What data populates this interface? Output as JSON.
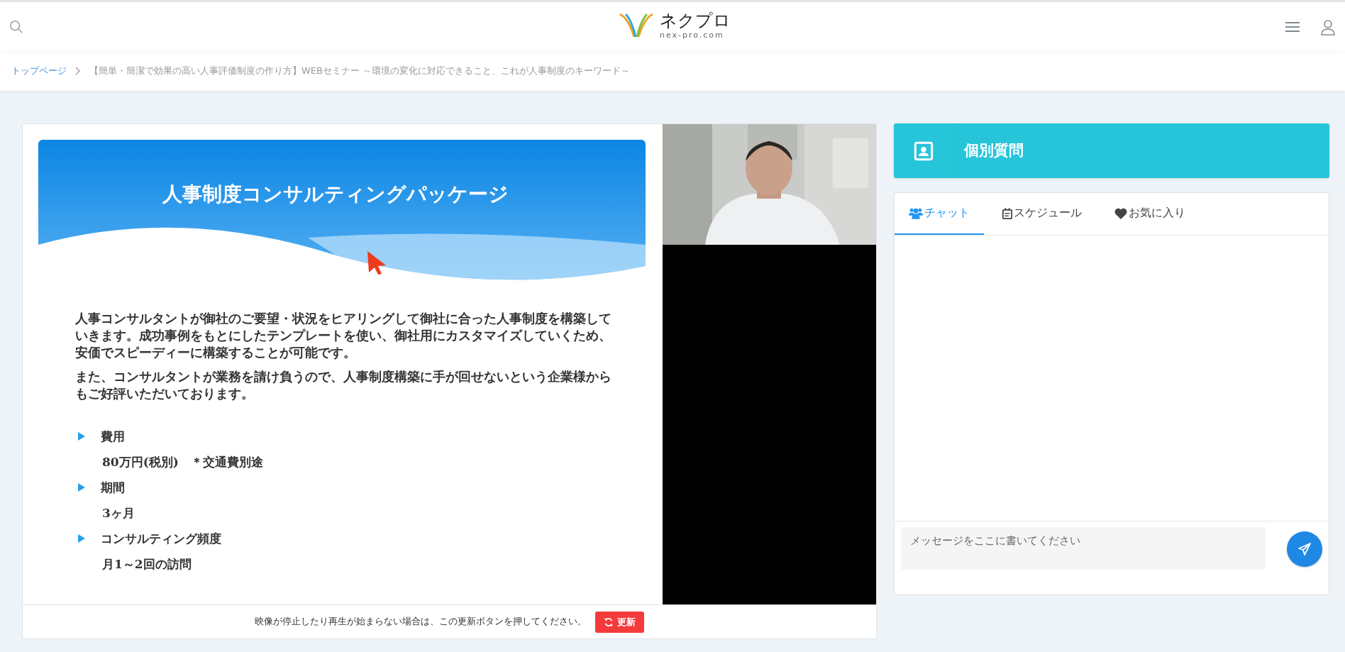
{
  "header": {
    "logo_name": "ネクプロ",
    "logo_domain": "nex-pro.com"
  },
  "breadcrumb": [
    {
      "label": "トップページ",
      "kind": "link"
    },
    {
      "label": "【簡単・簡潔で効果の高い人事評価制度の作り方】WEBセミナー ～環境の変化に対応できること、これが人事制度のキーワード～",
      "kind": "current"
    }
  ],
  "video": {
    "slide": {
      "title": "人事制度コンサルティングパッケージ",
      "paragraphs": [
        "人事コンサルタントが御社のご要望・状況をヒアリングして御社に合った人事制度を構築していきます。成功事例をもとにしたテンプレートを使い、御社用にカスタマイズしていくため、安価でスピーディーに構築することが可能です。",
        "また、コンサルタントが業務を請け負うので、人事制度構築に手が回せないという企業様からもご好評いただいております。"
      ],
      "items": [
        {
          "heading": "費用",
          "detail": "80万円(税別)　＊交通費別途"
        },
        {
          "heading": "期間",
          "detail": "3ヶ月"
        },
        {
          "heading": "コンサルティング頻度",
          "detail": "月1～2回の訪問"
        }
      ]
    },
    "notice": "映像が停止したり再生が始まらない場合は、この更新ボタンを押してください。",
    "refresh_button": "更新"
  },
  "question_panel": {
    "title": "個別質問"
  },
  "tabs": [
    {
      "label": "チャット",
      "kind": "chat",
      "selected": true
    },
    {
      "label": "スケジュール",
      "kind": "schedule",
      "selected": false
    },
    {
      "label": "お気に入り",
      "kind": "favorite",
      "selected": false
    }
  ],
  "message": {
    "placeholder": "メッセージをここに書いてください"
  }
}
